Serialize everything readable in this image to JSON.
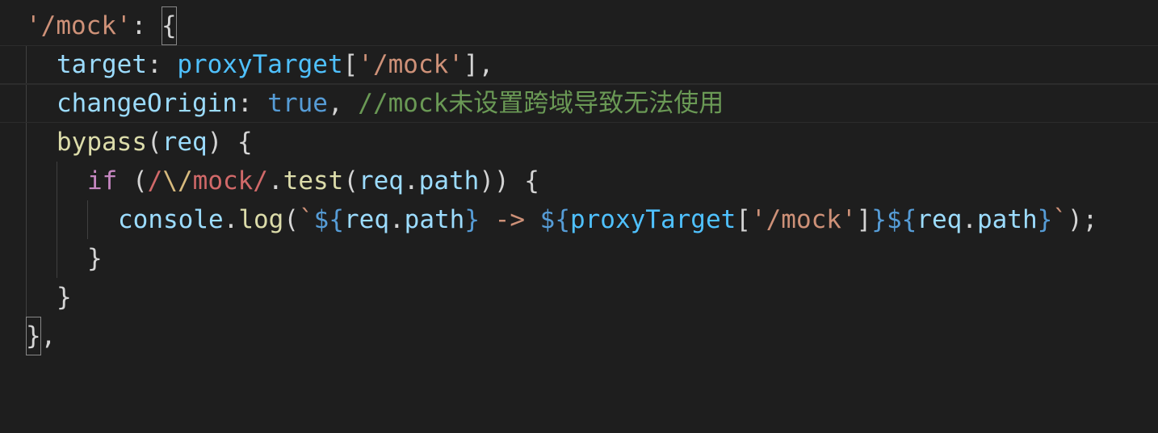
{
  "editor": {
    "language": "javascript",
    "theme": "dark",
    "lines": [
      {
        "id": "line-1",
        "text": "'/mock': {"
      },
      {
        "id": "line-2",
        "text": "target: proxyTarget['/mock'],"
      },
      {
        "id": "line-3",
        "text": "changeOrigin: true, //mock未设置跨域导致无法使用"
      },
      {
        "id": "line-4",
        "text": "bypass(req) {"
      },
      {
        "id": "line-5",
        "text": "if (/\\/mock/.test(req.path)) {"
      },
      {
        "id": "line-6",
        "text": "console.log(`${req.path} -> ${proxyTarget['/mock']}${req.path}`);"
      },
      {
        "id": "line-7",
        "text": "}"
      },
      {
        "id": "line-8",
        "text": "}"
      },
      {
        "id": "line-9",
        "text": "},"
      }
    ],
    "tokens": {
      "l1_key": "'/mock'",
      "l1_colon": ": ",
      "l1_brace": "{",
      "l2_prop": "target",
      "l2_colon": ": ",
      "l2_var": "proxyTarget",
      "l2_bracket_open": "[",
      "l2_str": "'/mock'",
      "l2_bracket_close": "],",
      "l3_prop": "changeOrigin",
      "l3_colon": ": ",
      "l3_bool": "true",
      "l3_comma": ", ",
      "l3_comment": "//mock未设置跨域导致无法使用",
      "l4_fn": "bypass",
      "l4_paren_open": "(",
      "l4_param": "req",
      "l4_paren_close": ") {",
      "l5_kw": "if",
      "l5_paren": " (",
      "l5_regex_open": "/",
      "l5_escape": "\\/",
      "l5_regex_body": "mock/",
      "l5_dot": ".",
      "l5_fn": "test",
      "l5_paren2": "(",
      "l5_obj": "req",
      "l5_dot2": ".",
      "l5_path": "path",
      "l5_close": ")) {",
      "l6_obj": "console",
      "l6_dot": ".",
      "l6_fn": "log",
      "l6_paren": "(",
      "l6_tick": "`",
      "l6_interp1_open": "${",
      "l6_req1": "req",
      "l6_dot1": ".",
      "l6_path1": "path",
      "l6_interp1_close": "}",
      "l6_arrow": " -> ",
      "l6_interp2_open": "${",
      "l6_proxy": "proxyTarget",
      "l6_br_open": "[",
      "l6_str": "'/mock'",
      "l6_br_close": "]",
      "l6_interp2_close": "}",
      "l6_interp3_open": "${",
      "l6_req3": "req",
      "l6_dot3": ".",
      "l6_path3": "path",
      "l6_interp3_close": "}",
      "l6_tick2": "`",
      "l6_end": ");",
      "l7_brace": "}",
      "l8_brace": "}",
      "l9_brace": "}",
      "l9_comma": ","
    }
  }
}
